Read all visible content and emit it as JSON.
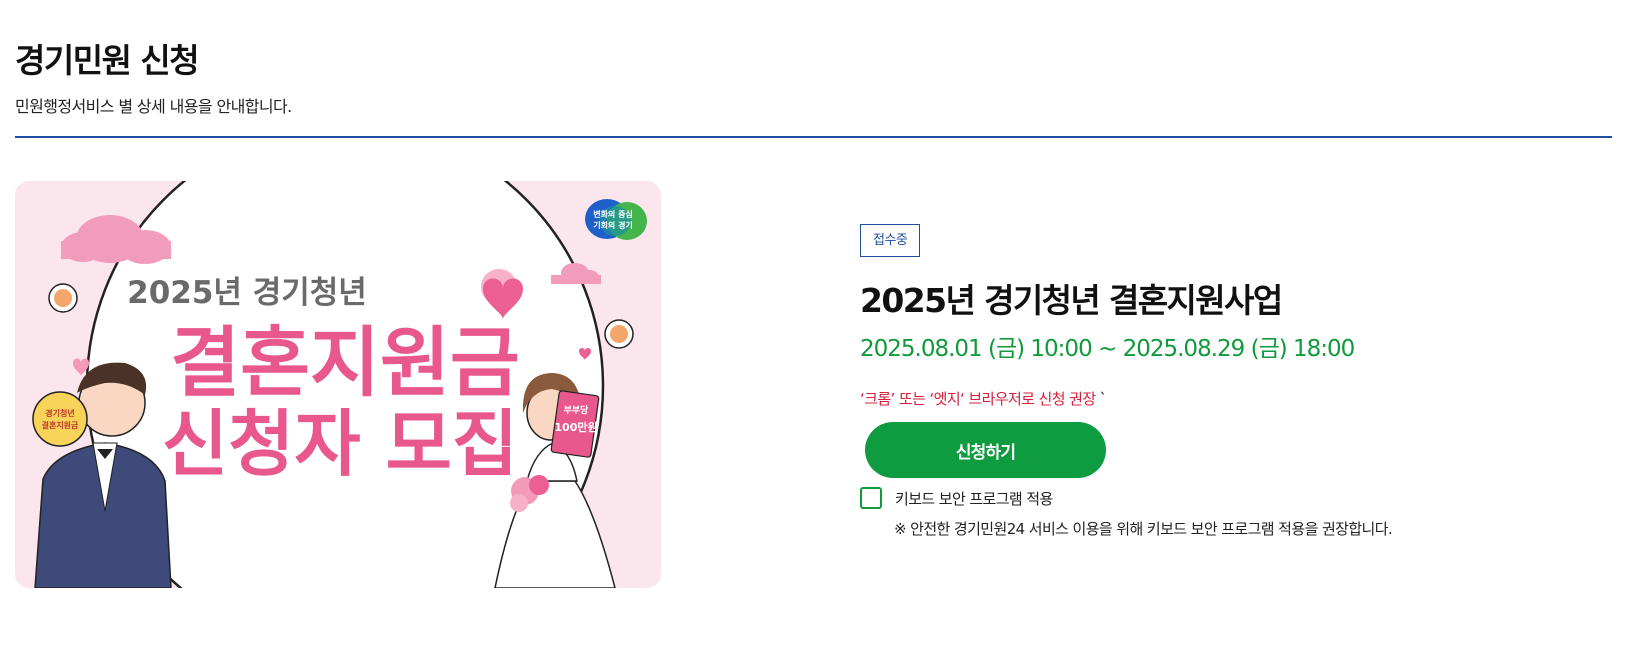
{
  "page": {
    "title": "경기민원 신청",
    "description": "민원행정서비스 별 상세 내용을 안내합니다."
  },
  "banner": {
    "year_line": "2025년 경기청년",
    "headline_line1": "결혼지원금",
    "headline_line2": "신청자 모집",
    "logo_line1": "변화의 중심",
    "logo_line2": "기회의 경기",
    "groom_sign_line1": "경기청년",
    "groom_sign_line2": "결혼지원금",
    "bride_card_line1": "부부당",
    "bride_card_line2": "100만원",
    "colors": {
      "pink": "#e8588c",
      "background": "#fbe6ee",
      "gray_text": "#6a6a6a",
      "suit": "#3d4a7a"
    }
  },
  "service": {
    "status_badge": "접수중",
    "title": "2025년 경기청년 결혼지원사업",
    "period": "2025.08.01 (금) 10:00 ~ 2025.08.29 (금) 18:00",
    "browser_note": "‘크롬’ 또는 ‘엣지‘ 브라우저로 신청 권장",
    "browser_note_tick": "`",
    "apply_button": "신청하기",
    "keyboard_security_label": "키보드 보안 프로그램 적용",
    "keyboard_security_note": "※ 안전한 경기민원24 서비스 이용을 위해 키보드 보안 프로그램 적용을 권장합니다.",
    "keyboard_security_checked": false
  },
  "colors": {
    "accent_blue": "#1f4fa0",
    "accent_green": "#0f9c40",
    "warning_red": "#d6203c"
  }
}
